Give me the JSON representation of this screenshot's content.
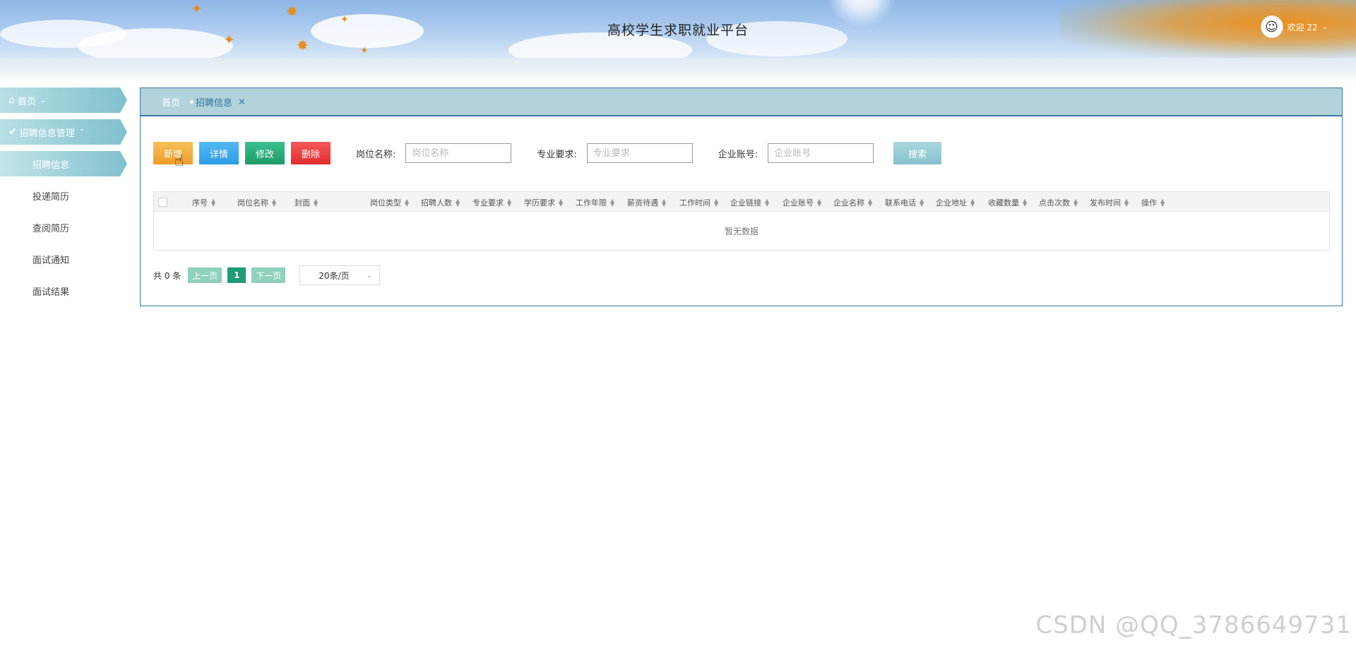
{
  "header": {
    "site_title": "高校学生求职就业平台",
    "welcome": "欢迎 22"
  },
  "sidebar": {
    "items": [
      {
        "label": "首页",
        "icon": "home-icon",
        "type": "top"
      },
      {
        "label": "招聘信息管理",
        "icon": "check-circle-icon",
        "type": "top"
      },
      {
        "label": "招聘信息",
        "type": "sub",
        "active": true
      },
      {
        "label": "投递简历",
        "type": "sub"
      },
      {
        "label": "查阅简历",
        "type": "sub"
      },
      {
        "label": "面试通知",
        "type": "sub"
      },
      {
        "label": "面试结果",
        "type": "sub"
      }
    ]
  },
  "tabs": {
    "home": "首页",
    "active": "招聘信息",
    "close": "×"
  },
  "toolbar": {
    "add": "新增",
    "detail": "详情",
    "edit": "修改",
    "delete": "删除",
    "search": "搜索"
  },
  "filters": {
    "job_name": {
      "label": "岗位名称:",
      "placeholder": "岗位名称"
    },
    "major": {
      "label": "专业要求:",
      "placeholder": "专业要求"
    },
    "account": {
      "label": "企业账号:",
      "placeholder": "企业账号"
    }
  },
  "table": {
    "columns": [
      "序号",
      "岗位名称",
      "封面",
      "岗位类型",
      "招聘人数",
      "专业要求",
      "学历要求",
      "工作年限",
      "薪资待遇",
      "工作时间",
      "企业链接",
      "企业账号",
      "企业名称",
      "联系电话",
      "企业地址",
      "收藏数量",
      "点击次数",
      "发布时间",
      "操作"
    ],
    "empty_text": "暂无数据"
  },
  "pagination": {
    "total": "共 0 条",
    "prev": "上一页",
    "page": "1",
    "next": "下一页",
    "page_size": "20条/页"
  },
  "watermark": "CSDN @QQ_3786649731",
  "colors": {
    "accent": "#3a78a5",
    "add": "#ef9b2c",
    "detail": "#2b9de8",
    "edit": "#1f9a68",
    "delete": "#e22d2d",
    "search": "#86c1cd"
  }
}
